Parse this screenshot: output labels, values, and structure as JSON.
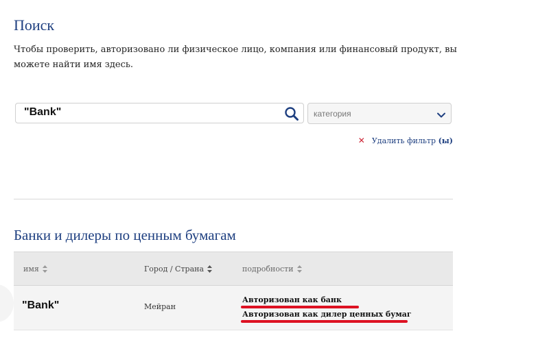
{
  "page": {
    "title": "Поиск",
    "intro": "Чтобы проверить, авторизовано ли физическое лицо, компания или финансовый продукт, вы можете найти имя здесь."
  },
  "search": {
    "value": "\"Bank\"",
    "icon": "search-icon",
    "category_value": "категория",
    "category_icon": "chevron-down-icon",
    "clear_filter_label": "Удалить фильтр",
    "clear_filter_suffix": "(ы)"
  },
  "results": {
    "section_title": "Банки и дилеры по ценным бумагам",
    "columns": [
      "имя",
      "Город / Страна",
      "подробности"
    ],
    "rows": [
      {
        "name": "\"Bank\"",
        "city": "Мейран",
        "details": [
          "Авторизован как банк",
          "Авторизован как дилер ценных бумаг"
        ]
      }
    ]
  },
  "colors": {
    "heading": "#1e3f80",
    "highlight": "#dd1122",
    "clear_x": "#cc2233"
  }
}
